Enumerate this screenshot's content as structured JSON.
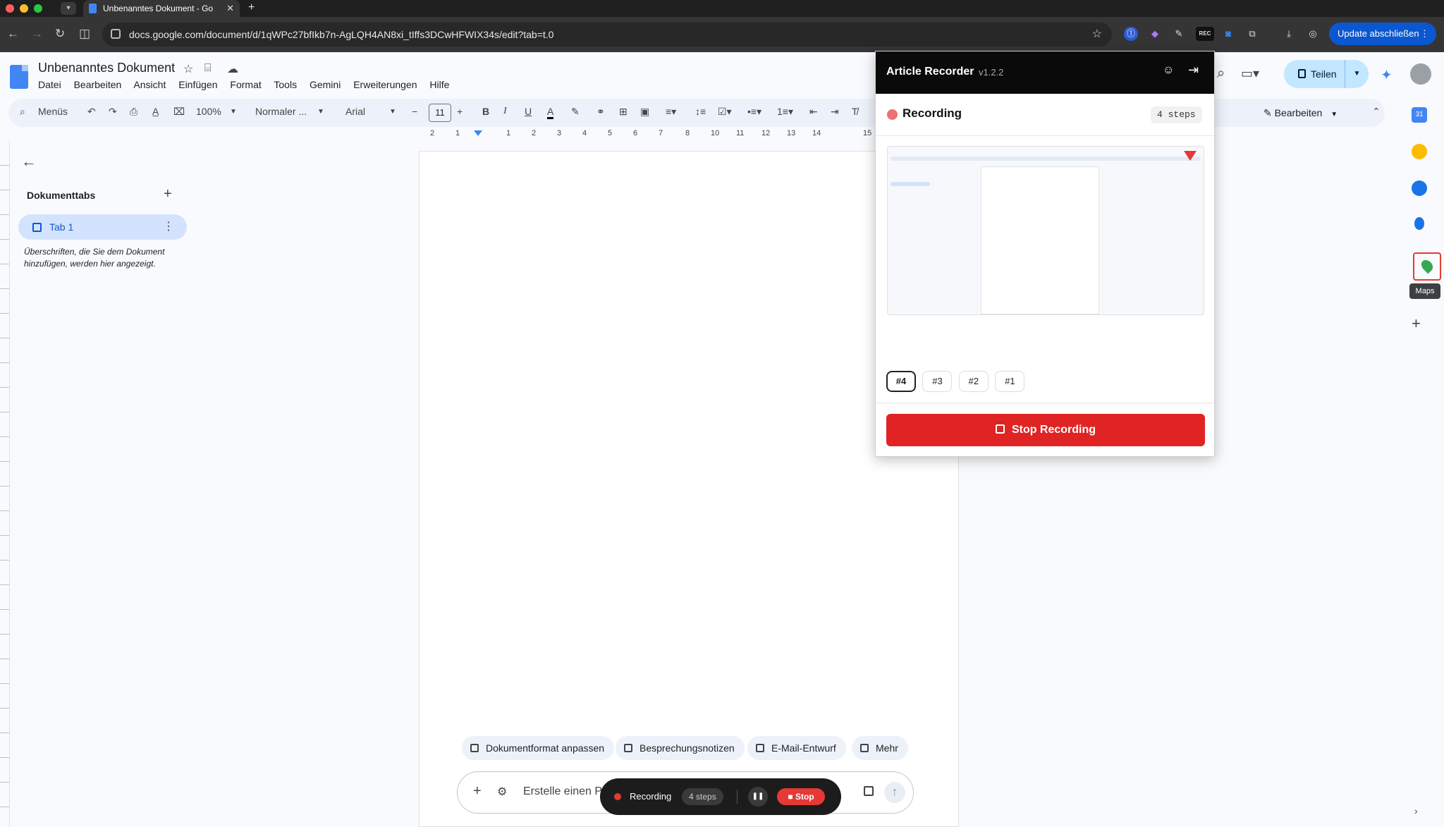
{
  "browser": {
    "tab_title": "Unbenanntes Dokument - Go",
    "new_tab": "+",
    "url": "docs.google.com/document/d/1qWPc27bfIkb7n-AgLQH4AN8xi_tIffs3DCwHFWIX34s/edit?tab=t.0",
    "update_label": "Update abschließen",
    "ext_rec_badge": "REC"
  },
  "docs": {
    "title": "Unbenanntes Dokument",
    "menu": [
      "Datei",
      "Bearbeiten",
      "Ansicht",
      "Einfügen",
      "Format",
      "Tools",
      "Gemini",
      "Erweiterungen",
      "Hilfe"
    ],
    "share_label": "Teilen"
  },
  "toolbar": {
    "search_label": "Menüs",
    "zoom": "100%",
    "style": "Normaler ...",
    "font": "Arial",
    "font_size": "11",
    "edit_mode": "Bearbeiten"
  },
  "ruler": [
    "2",
    "1",
    "1",
    "2",
    "3",
    "4",
    "5",
    "6",
    "7",
    "8",
    "10",
    "11",
    "12",
    "13",
    "14",
    "15"
  ],
  "outline": {
    "heading": "Dokumenttabs",
    "tab_label": "Tab 1",
    "hint": "Überschriften, die Sie dem Dokument hinzufügen, werden hier angezeigt."
  },
  "chips": [
    "Dokumentformat anpassen",
    "Besprechungsnotizen",
    "E-Mail-Entwurf",
    "Mehr"
  ],
  "prompt": {
    "placeholder": "Erstelle einen Pl"
  },
  "rec_pill": {
    "label": "Recording",
    "steps": "4 steps",
    "stop": "Stop"
  },
  "side_panel": {
    "maps_tooltip": "Maps",
    "add": "+"
  },
  "recorder": {
    "title": "Article Recorder",
    "version": "v1.2.2",
    "status": "Recording",
    "steps": "4 steps",
    "step_buttons": [
      "#4",
      "#3",
      "#2",
      "#1"
    ],
    "stop_label": "Stop Recording"
  },
  "colors": {
    "record_red": "#e02424",
    "accent_blue": "#0b57d0",
    "share_bg": "#c2e7ff"
  }
}
